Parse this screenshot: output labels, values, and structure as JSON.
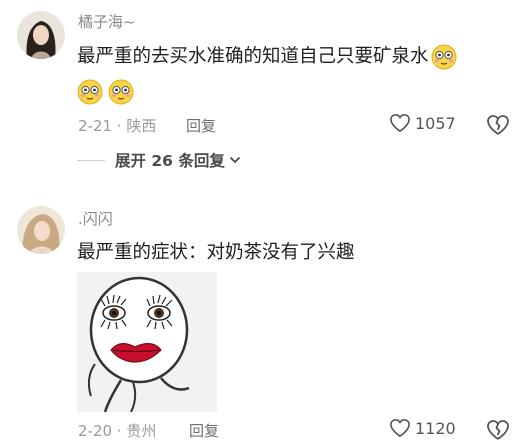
{
  "comments": [
    {
      "username": "橘子海~",
      "text": "最严重的去买水准确的知道自己只要矿泉水",
      "emojis": [
        "flushed-emoji",
        "flushed-emoji",
        "flushed-emoji"
      ],
      "date_location": "2-21 · 陕西",
      "reply_label": "回复",
      "likes": "1057",
      "expand_replies": "展开 26 条回复"
    },
    {
      "username": ".闪闪",
      "text": "最严重的症状：对奶茶没有了兴趣",
      "image": "meme-face-sticker",
      "date_location": "2-20 · 贵州",
      "reply_label": "回复",
      "likes": "1120"
    }
  ],
  "colors": {
    "username": "#8a8a8a",
    "meta": "#9a9a9a",
    "emoji_face": "#f8d44a",
    "lips": "#c8102e"
  }
}
